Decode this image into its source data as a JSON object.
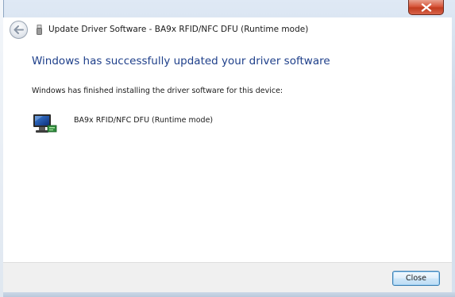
{
  "window": {
    "title": "Update Driver Software - BA9x RFID/NFC DFU (Runtime mode)"
  },
  "content": {
    "heading": "Windows has successfully updated your driver software",
    "description": "Windows has finished installing the driver software for this device:",
    "device_name": "BA9x RFID/NFC DFU (Runtime mode)"
  },
  "footer": {
    "close_label": "Close"
  },
  "icons": {
    "back": "back-arrow-icon",
    "title": "usb-device-icon",
    "device": "computer-monitor-icon",
    "window_close": "close-x-icon"
  },
  "colors": {
    "heading": "#1e3f8a",
    "close_button_red": "#c23c1f",
    "button_border": "#3c7fb1"
  }
}
